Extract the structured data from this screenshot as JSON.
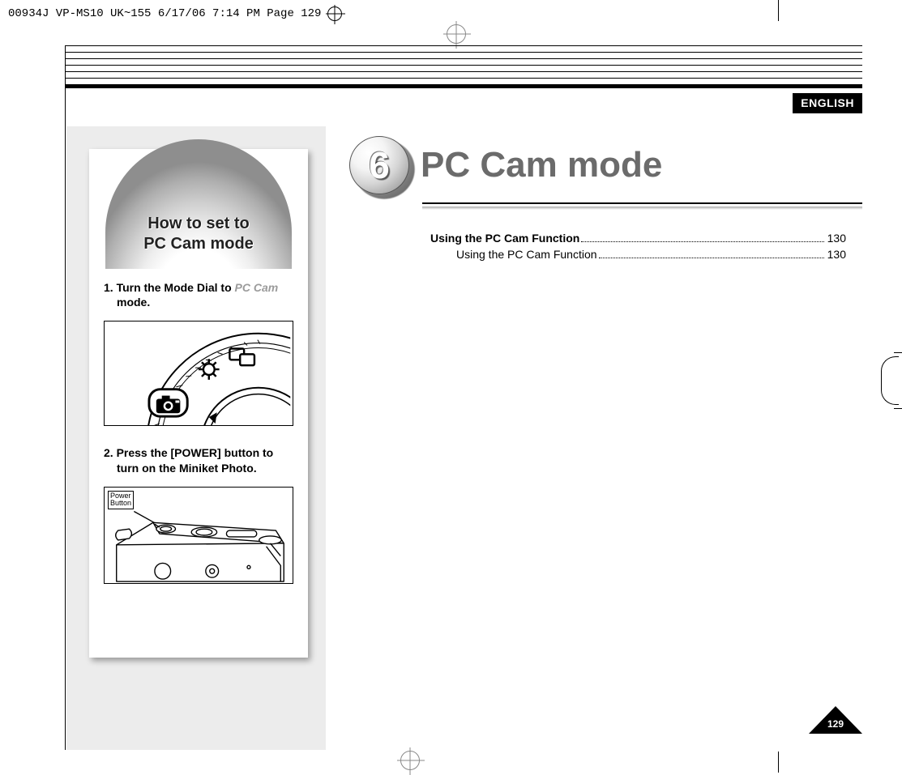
{
  "print_header": "00934J VP-MS10 UK~155  6/17/06 7:14 PM  Page 129",
  "language_tab": "ENGLISH",
  "sidebar": {
    "arch_title_line1": "How to set to",
    "arch_title_line2": "PC Cam mode",
    "step1_prefix": "1.  Turn the Mode Dial to ",
    "step1_grey": "PC Cam",
    "step1_suffix": "mode.",
    "step2": "2.  Press the [POWER] button to",
    "step2_cont": "turn on the Miniket Photo.",
    "power_label_line1": "Power",
    "power_label_line2": "Button"
  },
  "chapter": {
    "number": "6",
    "title": "PC Cam mode"
  },
  "toc": [
    {
      "label": "Using the PC Cam Function",
      "page": "130",
      "bold": true,
      "sub": false
    },
    {
      "label": "Using the PC Cam Function",
      "page": "130",
      "bold": false,
      "sub": true
    }
  ],
  "page_number": "129"
}
